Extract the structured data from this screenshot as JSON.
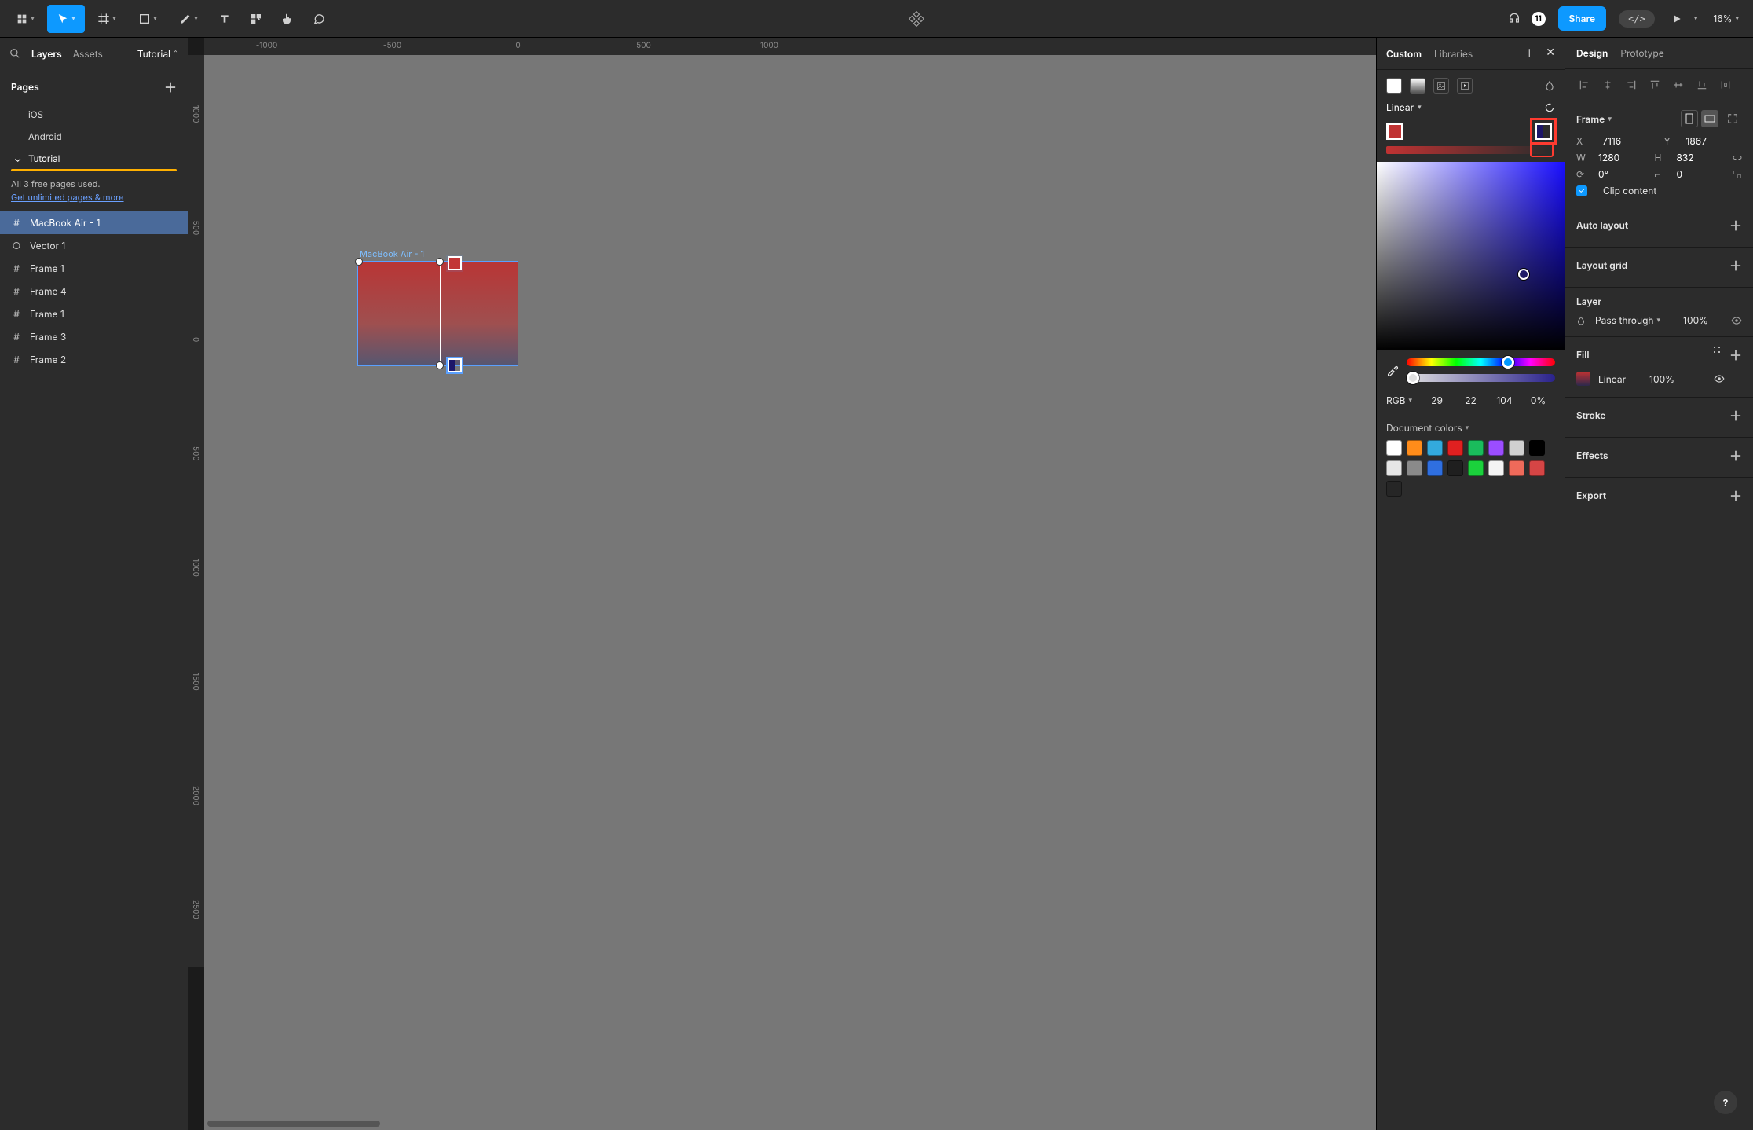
{
  "toolbar": {
    "zoom": "16%",
    "share": "Share"
  },
  "collab_count": "11",
  "left": {
    "tabs": {
      "layers": "Layers",
      "assets": "Assets"
    },
    "filename": "Tutorial",
    "pages_label": "Pages",
    "pages": [
      "iOS",
      "Android",
      "Tutorial"
    ],
    "upgrade_line1": "All 3 free pages used.",
    "upgrade_link": "Get unlimited pages & more",
    "layers": [
      {
        "name": "MacBook Air - 1",
        "glyph": "#",
        "selected": true
      },
      {
        "name": "Vector 1",
        "glyph": "○"
      },
      {
        "name": "Frame 1",
        "glyph": "#"
      },
      {
        "name": "Frame 4",
        "glyph": "#"
      },
      {
        "name": "Frame 1",
        "glyph": "#"
      },
      {
        "name": "Frame 3",
        "glyph": "#"
      },
      {
        "name": "Frame 2",
        "glyph": "#"
      }
    ]
  },
  "canvas": {
    "ruler_h": [
      "-1000",
      "-500",
      "0",
      "500",
      "1000"
    ],
    "ruler_v": [
      "-1000",
      "-500",
      "0",
      "500",
      "1000",
      "1500",
      "2000",
      "2500"
    ],
    "frame_label": "MacBook Air - 1"
  },
  "colorpanel": {
    "tabs": {
      "custom": "Custom",
      "libraries": "Libraries"
    },
    "gradient_type": "Linear",
    "colormode": "RGB",
    "r": "29",
    "g": "22",
    "b": "104",
    "a": "0%",
    "doc_colors_label": "Document colors",
    "doc_colors": [
      "#ffffff",
      "#ff8c1a",
      "#33aadd",
      "#e02020",
      "#1abc5c",
      "#9b4dff",
      "#d0d0d0",
      "#000000",
      "#e6e6e6",
      "#8a8a8a",
      "#2f6fe0",
      "#1f1f1f",
      "#1bd13c",
      "#f4f4f4",
      "#ef6a5a",
      "#d54545",
      "#262626"
    ]
  },
  "inspector": {
    "tabs": {
      "design": "Design",
      "prototype": "Prototype"
    },
    "frame_label": "Frame",
    "x": "-7116",
    "y": "1867",
    "w": "1280",
    "h": "832",
    "rotation": "0°",
    "radius": "0",
    "clip": "Clip content",
    "auto_layout": "Auto layout",
    "layout_grid": "Layout grid",
    "layer_label": "Layer",
    "blend": "Pass through",
    "layer_opacity": "100%",
    "fill_label": "Fill",
    "fill_type": "Linear",
    "fill_opacity": "100%",
    "stroke_label": "Stroke",
    "effects_label": "Effects",
    "export_label": "Export"
  }
}
